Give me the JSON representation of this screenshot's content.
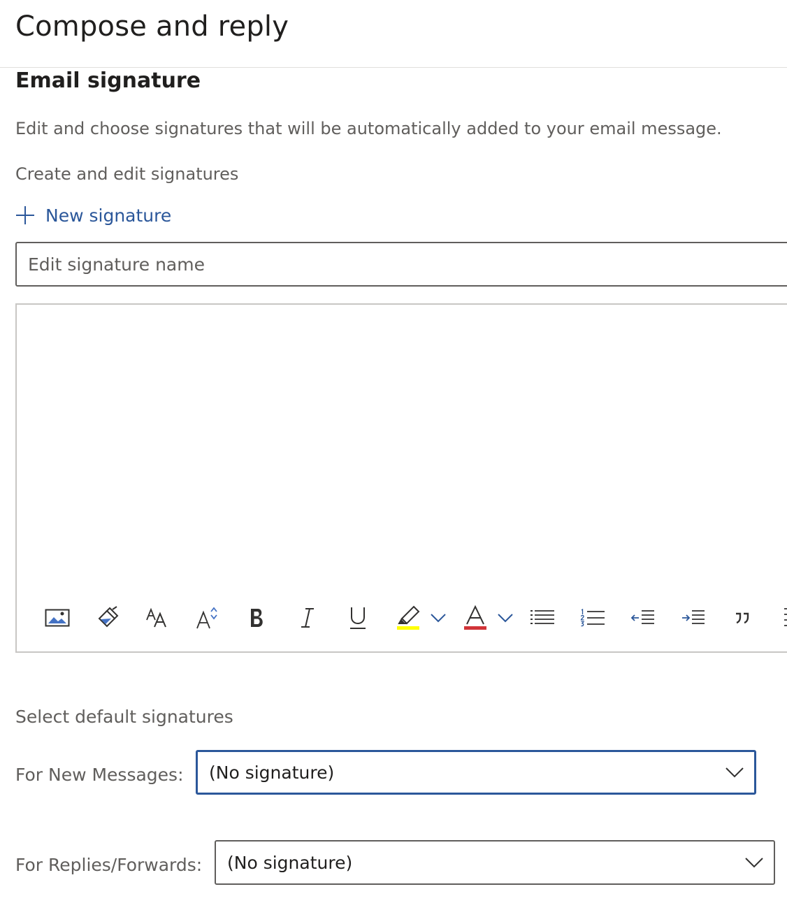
{
  "header": {
    "title": "Compose and reply"
  },
  "section": {
    "title": "Email signature",
    "description": "Edit and choose signatures that will be automatically added to your email message.",
    "create_label": "Create and edit signatures",
    "new_signature_label": "New signature"
  },
  "editor": {
    "name_placeholder": "Edit signature name",
    "name_value": "",
    "toolbar_icons": [
      "insert-picture-icon",
      "format-painter-icon",
      "font-size-icon",
      "grow-font-icon",
      "bold-icon",
      "italic-icon",
      "underline-icon",
      "highlight-icon",
      "highlight-dropdown-icon",
      "font-color-icon",
      "font-color-dropdown-icon",
      "bullets-icon",
      "numbering-icon",
      "decrease-indent-icon",
      "increase-indent-icon",
      "quote-icon",
      "more-options-icon"
    ],
    "highlight_color": "#ffff00",
    "font_color": "#d13438"
  },
  "defaults": {
    "label": "Select default signatures",
    "new_messages": {
      "label": "For New Messages:",
      "value": "(No signature)"
    },
    "replies": {
      "label": "For Replies/Forwards:",
      "value": "(No signature)"
    }
  },
  "colors": {
    "accent": "#2b579a",
    "text_primary": "#201f1e",
    "text_secondary": "#605e5c",
    "border": "#c8c6c4"
  }
}
